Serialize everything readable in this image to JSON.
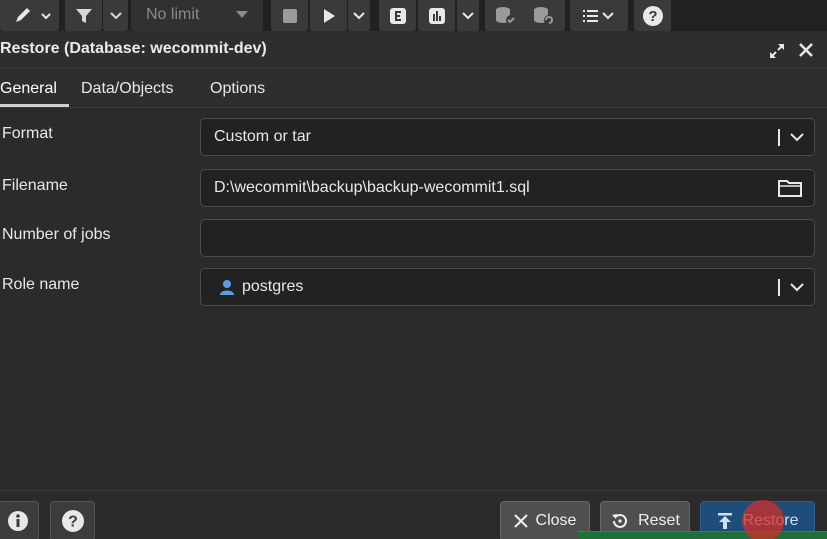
{
  "toolbar": {
    "limit_placeholder": "No limit",
    "items": [
      {
        "name": "edit-icon"
      },
      {
        "name": "filter-icon"
      },
      {
        "name": "stop-icon"
      },
      {
        "name": "play-icon"
      },
      {
        "name": "explain-icon"
      },
      {
        "name": "explain-analyze-icon"
      },
      {
        "name": "commit-icon"
      },
      {
        "name": "rollback-icon"
      },
      {
        "name": "macros-icon"
      },
      {
        "name": "help-icon"
      }
    ]
  },
  "dialog": {
    "title": "Restore (Database: wecommit-dev)",
    "tabs": [
      "General",
      "Data/Objects",
      "Options"
    ],
    "active_tab": "General",
    "fields": {
      "format": {
        "label": "Format",
        "value": "Custom or tar"
      },
      "filename": {
        "label": "Filename",
        "value": "D:\\wecommit\\backup\\backup-wecommit1.sql"
      },
      "jobs": {
        "label": "Number of jobs",
        "value": ""
      },
      "role": {
        "label": "Role name",
        "value": "postgres"
      }
    }
  },
  "footer": {
    "close_label": "Close",
    "reset_label": "Reset",
    "restore_label": "Restore"
  },
  "colors": {
    "primary_button": "#1f4d7a",
    "background": "#2b2b2b",
    "field_background": "#222222"
  }
}
